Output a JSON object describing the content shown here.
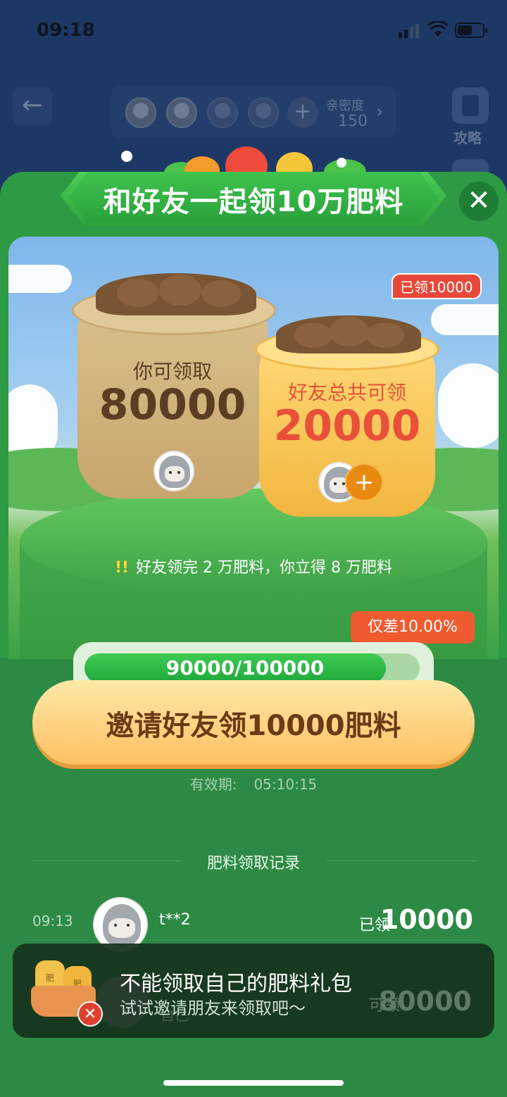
{
  "status_bar": {
    "time": "09:18"
  },
  "background_app": {
    "intimacy_label": "亲密度",
    "intimacy_value": "150",
    "guide_label": "攻略",
    "plus_symbol": "+"
  },
  "modal": {
    "title": "和好友一起领10万肥料",
    "close_symbol": "✕",
    "your_sack": {
      "label": "你可领取",
      "amount": "80000"
    },
    "friend_sack": {
      "label": "好友总共可领",
      "amount": "20000",
      "claimed_tag": "已领10000",
      "plus_symbol": "+"
    },
    "tip_text": "好友领完 2 万肥料，你立得 8 万肥料",
    "progress": {
      "tip": "仅差10.00%",
      "text": "90000/100000",
      "fraction": 0.9
    },
    "invite_button": "邀请好友领10000肥料",
    "validity_label": "有效期:",
    "validity_time": "05:10:15",
    "records_title": "肥料领取记录",
    "records": [
      {
        "time": "09:13",
        "name": "t**2",
        "status": "已领",
        "amount": "10000"
      }
    ]
  },
  "toast": {
    "title": "不能领取自己的肥料礼包",
    "subtitle": "试试邀请朋友来领取吧～",
    "background_row": {
      "name": "自己",
      "status": "可领",
      "amount": "80000"
    },
    "basket_label": "肥",
    "x_symbol": "✕"
  },
  "colors": {
    "modal_green": "#2e9a44",
    "invite_button": "#ffc062",
    "progress_fill": "#1fa83c",
    "tip_red": "#f05a2f",
    "claimed_red": "#e8483a",
    "friend_amount": "#e8503a",
    "your_amount": "#5a3d22"
  }
}
